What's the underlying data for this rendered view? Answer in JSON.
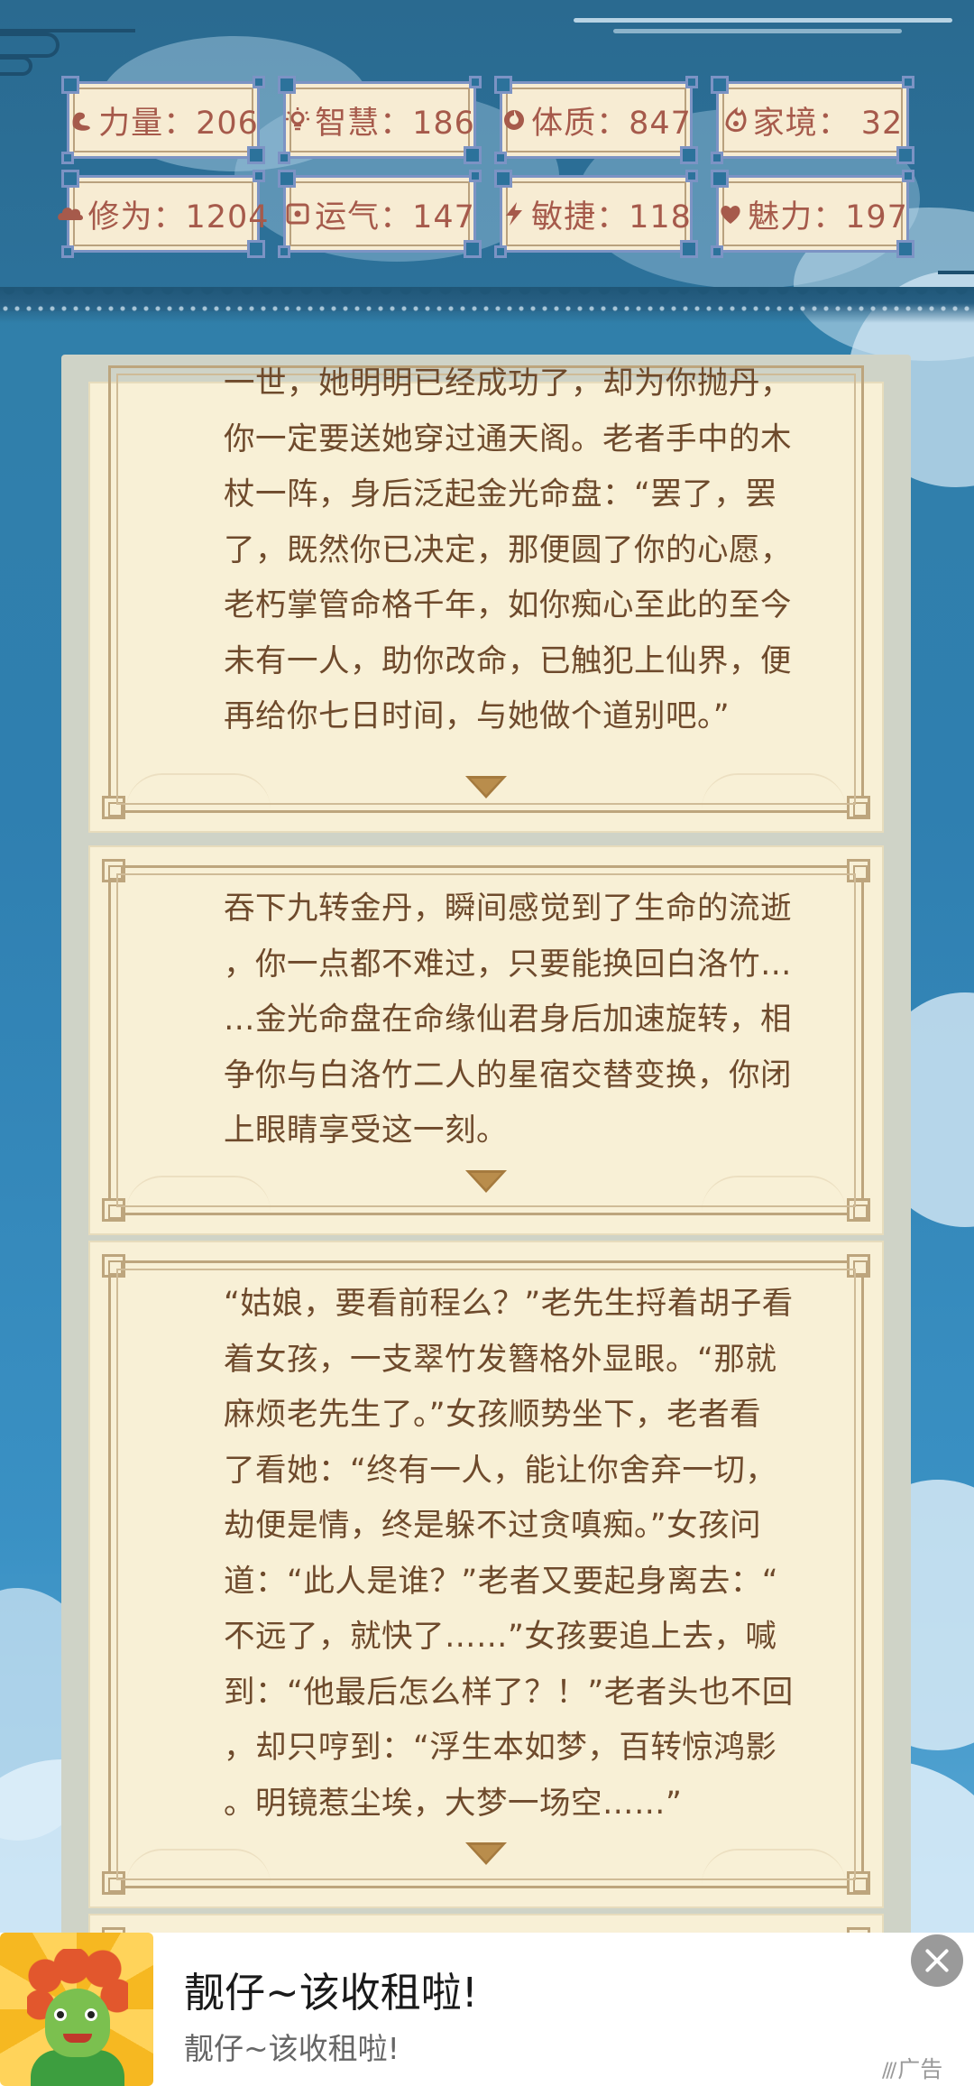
{
  "stats": [
    {
      "label": "力量：206",
      "icon": "strength-icon"
    },
    {
      "label": "智慧：186",
      "icon": "wisdom-icon"
    },
    {
      "label": "体质：847",
      "icon": "constitution-icon"
    },
    {
      "label": "家境：  32",
      "icon": "family-icon"
    },
    {
      "label": "修为：1204",
      "icon": "cultivation-icon"
    },
    {
      "label": "运气：147",
      "icon": "luck-icon"
    },
    {
      "label": "敏捷：118",
      "icon": "agility-icon"
    },
    {
      "label": "魅力：197",
      "icon": "charm-icon"
    }
  ],
  "cards": [
    {
      "text": "一世，她明明已经成功了，却为你抛丹，\n你一定要送她穿过通天阁。老者手中的木\n杖一阵，身后泛起金光命盘：“罢了，罢\n了，既然你已决定，那便圆了你的心愿，\n老朽掌管命格千年，如你痴心至此的至今\n未有一人，助你改命，已触犯上仙界，便\n再给你七日时间，与她做个道别吧。”"
    },
    {
      "text": "吞下九转金丹，瞬间感觉到了生命的流逝\n，你一点都不难过，只要能换回白洛竹…\n…金光命盘在命缘仙君身后加速旋转，相\n争你与白洛竹二人的星宿交替变换，你闭\n上眼睛享受这一刻。"
    },
    {
      "text": "“姑娘，要看前程么？”老先生捋着胡子看\n着女孩，一支翠竹发簪格外显眼。“那就\n麻烦老先生了。”女孩顺势坐下，老者看\n了看她：“终有一人，能让你舍弃一切，\n劫便是情，终是躲不过贪嗔痴。”女孩问\n道：“此人是谁？”老者又要起身离去：“\n不远了，就快了……”女孩要追上去，喊\n到：“他最后怎么样了？！”老者头也不回\n，却只哼到：“浮生本如梦，百转惊鸿影\n。明镜惹尘埃，大梦一场空……”"
    }
  ],
  "ad": {
    "title": "靓仔~该收租啦!",
    "subtitle": "靓仔~该收租啦!",
    "mark": "广告",
    "mark_icon": "ad-brand-icon"
  },
  "colors": {
    "stat_text": "#a65a4b",
    "card_text": "#6e4a2c",
    "arrow": "#a57a3e",
    "background": "#2e7ba5"
  }
}
